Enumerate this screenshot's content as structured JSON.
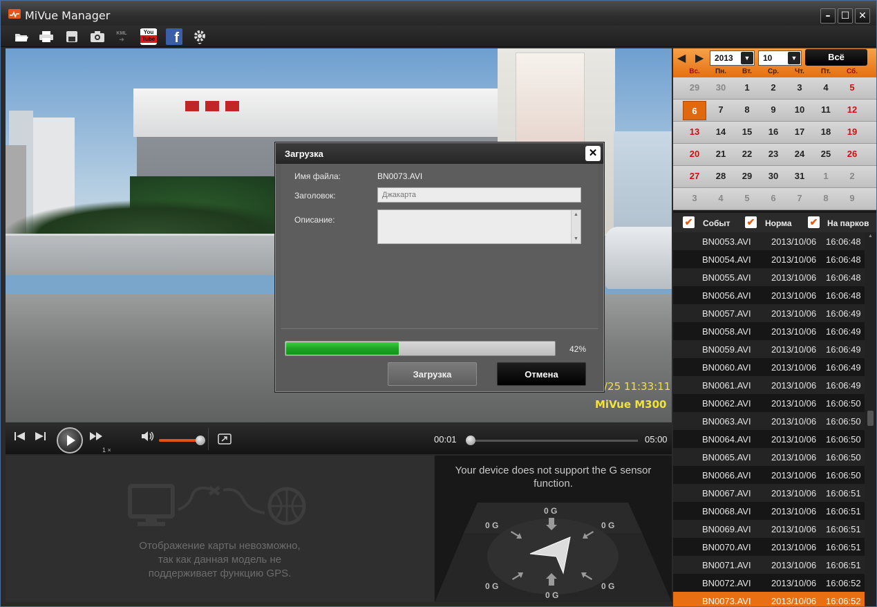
{
  "window": {
    "title": "MiVue Manager"
  },
  "toolbar": {
    "kml_label": "KML",
    "youtube_label": "You Tube",
    "facebook_label": "f"
  },
  "video": {
    "timestamp": "/25 11:33:11",
    "brand": "MiVue M300"
  },
  "dialog": {
    "title": "Загрузка",
    "filename_label": "Имя файла:",
    "filename_value": "BN0073.AVI",
    "heading_label": "Заголовок:",
    "heading_value": "Джакарта",
    "description_label": "Описание:",
    "description_value": "",
    "progress_percent": 42,
    "progress_text": "42%",
    "upload_button": "Загрузка",
    "cancel_button": "Отмена"
  },
  "player": {
    "speed": "1 ×",
    "current_time": "00:01",
    "total_time": "05:00",
    "volume_level": 1.0,
    "seek_position": 0.0
  },
  "map": {
    "message_lines": [
      "Отображение карты невозможно,",
      "так как данная модель не",
      "поддерживает функцию GPS."
    ]
  },
  "gsensor": {
    "message_lines": [
      "Your device does not support the G sensor",
      "function."
    ],
    "labels": [
      "0 G",
      "0 G",
      "0 G",
      "0 G",
      "0 G",
      "0 G"
    ]
  },
  "calendar": {
    "year": "2013",
    "month": "10",
    "all_button": "Всё",
    "weekdays": [
      "Вс.",
      "Пн.",
      "Вт.",
      "Ср.",
      "Чт.",
      "Пт.",
      "Сб."
    ],
    "weeks": [
      [
        "29",
        "30",
        "1",
        "2",
        "3",
        "4",
        "5"
      ],
      [
        "6",
        "7",
        "8",
        "9",
        "10",
        "11",
        "12"
      ],
      [
        "13",
        "14",
        "15",
        "16",
        "17",
        "18",
        "19"
      ],
      [
        "20",
        "21",
        "22",
        "23",
        "24",
        "25",
        "26"
      ],
      [
        "27",
        "28",
        "29",
        "30",
        "31",
        "1",
        "2"
      ],
      [
        "3",
        "4",
        "5",
        "6",
        "7",
        "8",
        "9"
      ]
    ],
    "selected_day": "6"
  },
  "filters": {
    "event": "Событ",
    "normal": "Норма",
    "parking": "На парков"
  },
  "files": [
    {
      "name": "BN0053.AVI",
      "date": "2013/10/06",
      "time": "16:06:48"
    },
    {
      "name": "BN0054.AVI",
      "date": "2013/10/06",
      "time": "16:06:48"
    },
    {
      "name": "BN0055.AVI",
      "date": "2013/10/06",
      "time": "16:06:48"
    },
    {
      "name": "BN0056.AVI",
      "date": "2013/10/06",
      "time": "16:06:48"
    },
    {
      "name": "BN0057.AVI",
      "date": "2013/10/06",
      "time": "16:06:49"
    },
    {
      "name": "BN0058.AVI",
      "date": "2013/10/06",
      "time": "16:06:49"
    },
    {
      "name": "BN0059.AVI",
      "date": "2013/10/06",
      "time": "16:06:49"
    },
    {
      "name": "BN0060.AVI",
      "date": "2013/10/06",
      "time": "16:06:49"
    },
    {
      "name": "BN0061.AVI",
      "date": "2013/10/06",
      "time": "16:06:49"
    },
    {
      "name": "BN0062.AVI",
      "date": "2013/10/06",
      "time": "16:06:50"
    },
    {
      "name": "BN0063.AVI",
      "date": "2013/10/06",
      "time": "16:06:50"
    },
    {
      "name": "BN0064.AVI",
      "date": "2013/10/06",
      "time": "16:06:50"
    },
    {
      "name": "BN0065.AVI",
      "date": "2013/10/06",
      "time": "16:06:50"
    },
    {
      "name": "BN0066.AVI",
      "date": "2013/10/06",
      "time": "16:06:50"
    },
    {
      "name": "BN0067.AVI",
      "date": "2013/10/06",
      "time": "16:06:51"
    },
    {
      "name": "BN0068.AVI",
      "date": "2013/10/06",
      "time": "16:06:51"
    },
    {
      "name": "BN0069.AVI",
      "date": "2013/10/06",
      "time": "16:06:51"
    },
    {
      "name": "BN0070.AVI",
      "date": "2013/10/06",
      "time": "16:06:51"
    },
    {
      "name": "BN0071.AVI",
      "date": "2013/10/06",
      "time": "16:06:51"
    },
    {
      "name": "BN0072.AVI",
      "date": "2013/10/06",
      "time": "16:06:52"
    },
    {
      "name": "BN0073.AVI",
      "date": "2013/10/06",
      "time": "16:06:52"
    }
  ],
  "active_file": "BN0073.AVI",
  "colors": {
    "accent": "#e86f12",
    "progress": "#1ea325",
    "weekend": "#c91010"
  }
}
